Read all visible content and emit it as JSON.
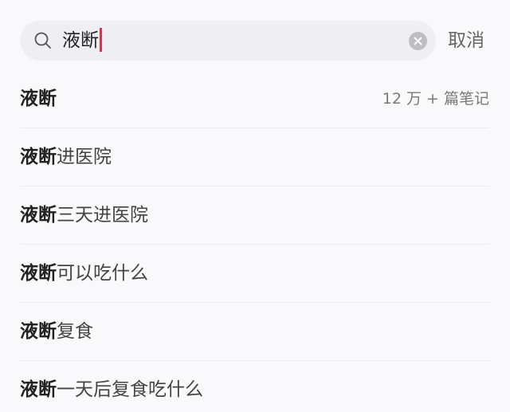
{
  "search": {
    "query": "液断",
    "cancel_label": "取消"
  },
  "suggestions": [
    {
      "keyword": "液断",
      "rest": "",
      "meta": "12 万 + 篇笔记"
    },
    {
      "keyword": "液断",
      "rest": "进医院",
      "meta": ""
    },
    {
      "keyword": "液断",
      "rest": "三天进医院",
      "meta": ""
    },
    {
      "keyword": "液断",
      "rest": "可以吃什么",
      "meta": ""
    },
    {
      "keyword": "液断",
      "rest": "复食",
      "meta": ""
    },
    {
      "keyword": "液断",
      "rest": "一天后复食吃什么",
      "meta": ""
    }
  ],
  "colors": {
    "background": "#f9f9fb",
    "search_box": "#efeff3",
    "caret": "#e5304a",
    "clear_icon": "#bdbdc2"
  },
  "icons": {
    "search": "search-icon",
    "clear": "clear-icon"
  }
}
